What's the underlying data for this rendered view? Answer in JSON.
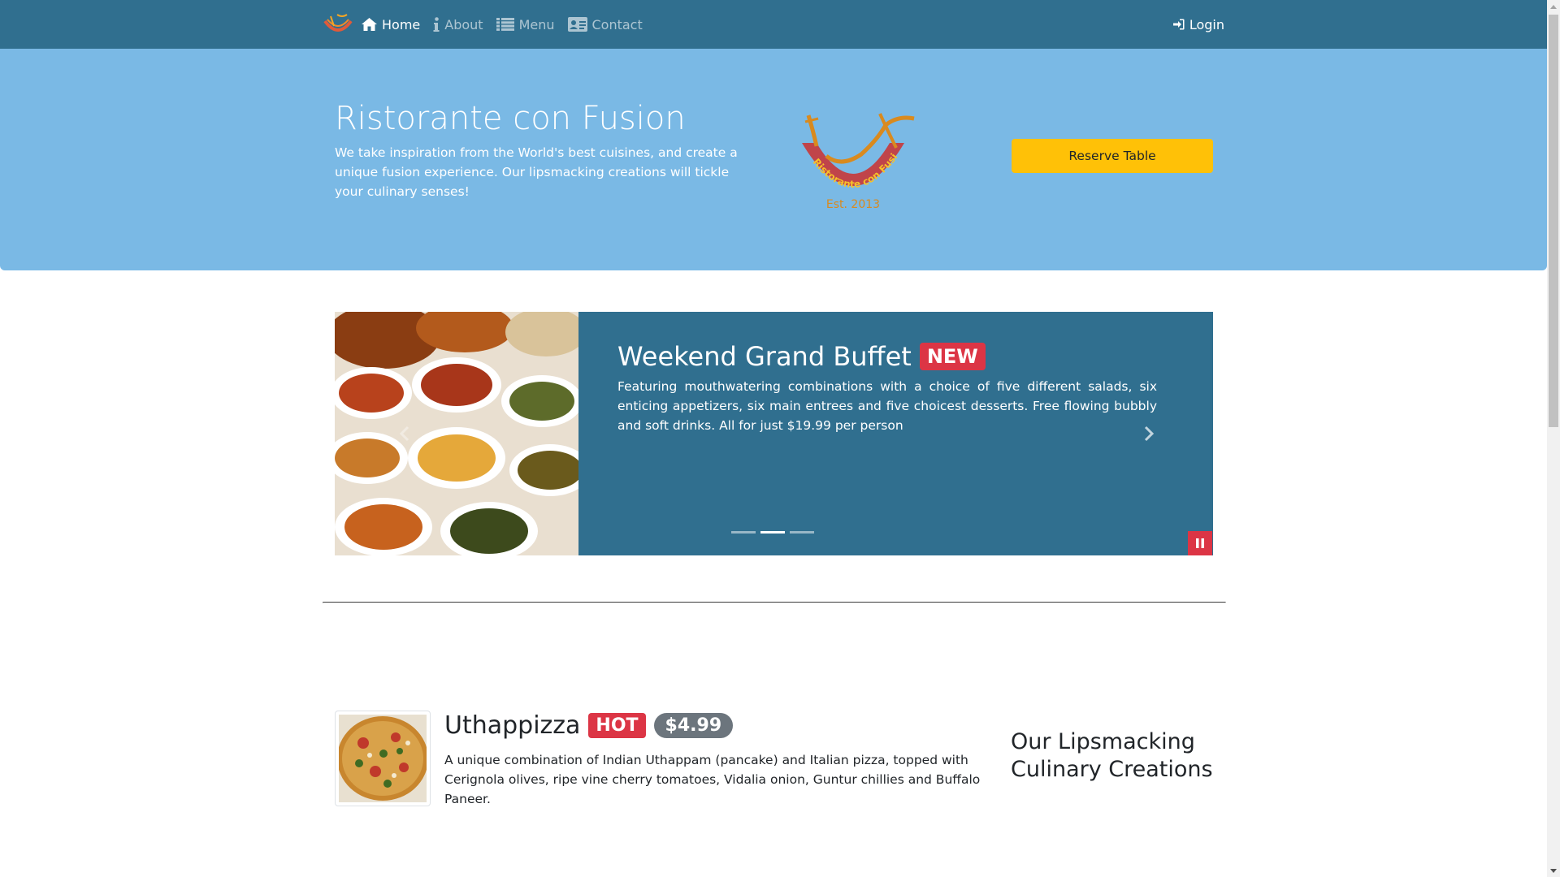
{
  "navbar": {
    "brand_logo": "restaurant-logo-small",
    "links": [
      {
        "label": "Home",
        "icon": "home-icon",
        "active": true
      },
      {
        "label": "About",
        "icon": "info-icon",
        "active": false
      },
      {
        "label": "Menu",
        "icon": "list-icon",
        "active": false
      },
      {
        "label": "Contact",
        "icon": "address-card-icon",
        "active": false
      }
    ],
    "login_label": "Login",
    "login_icon": "sign-in-icon",
    "bg_color": "#306f8f"
  },
  "jumbotron": {
    "title": "Ristorante con Fusion",
    "description": "We take inspiration from the World's best cuisines, and create a unique fusion experience. Our lipsmacking creations will tickle your culinary senses!",
    "logo_text": "Ristorante con Fusion",
    "logo_est": "Est. 2013",
    "reserve_button": "Reserve Table",
    "bg_color": "#7ab9e5",
    "button_color": "#ffc107"
  },
  "carousel": {
    "slide_title": "Weekend Grand Buffet",
    "slide_badge": "NEW",
    "slide_description": "Featuring mouthwatering combinations with a choice of five different salads, six enticing appetizers, six main entrees and five choicest desserts. Free flowing bubbly and soft drinks. All for just $19.99 per person",
    "image": "buffet-dishes-image",
    "indicators_count": 3,
    "active_indicator": 2,
    "pause_icon": "pause-icon",
    "next_icon": "chevron-right-icon",
    "prev_icon": "chevron-left-icon"
  },
  "featured": {
    "dish_name": "Uthappizza",
    "dish_badge": "HOT",
    "dish_price": "$4.99",
    "dish_description": "A unique combination of Indian Uthappam (pancake) and Italian pizza, topped with Cerignola olives, ripe vine cherry tomatoes, Vidalia onion, Guntur chillies and Buffalo Paneer.",
    "dish_image": "uthappizza-image",
    "aside_title": "Our Lipsmacking Culinary Creations"
  },
  "colors": {
    "danger": "#dc3545",
    "secondary": "#6c757d"
  }
}
